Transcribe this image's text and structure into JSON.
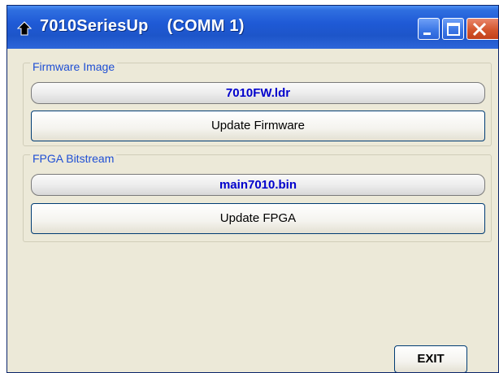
{
  "window": {
    "title": "7010SeriesUp    (COMM 1)",
    "icon": "arrow-up-icon",
    "controls": {
      "minimize_icon": "minimize-icon",
      "maximize_icon": "maximize-icon",
      "close_icon": "close-icon"
    }
  },
  "firmware": {
    "group_label": "Firmware Image",
    "file_name": "7010FW.ldr",
    "update_button": "Update Firmware"
  },
  "fpga": {
    "group_label": "FPGA Bitstream",
    "file_name": "main7010.bin",
    "update_button": "Update FPGA"
  },
  "exit_button": "EXIT",
  "colors": {
    "titlebar": "#1f5ad6",
    "window_bg": "#ece9d8",
    "group_label": "#1f4fd4",
    "file_text": "#0000cc",
    "close_button": "#d4562e"
  }
}
